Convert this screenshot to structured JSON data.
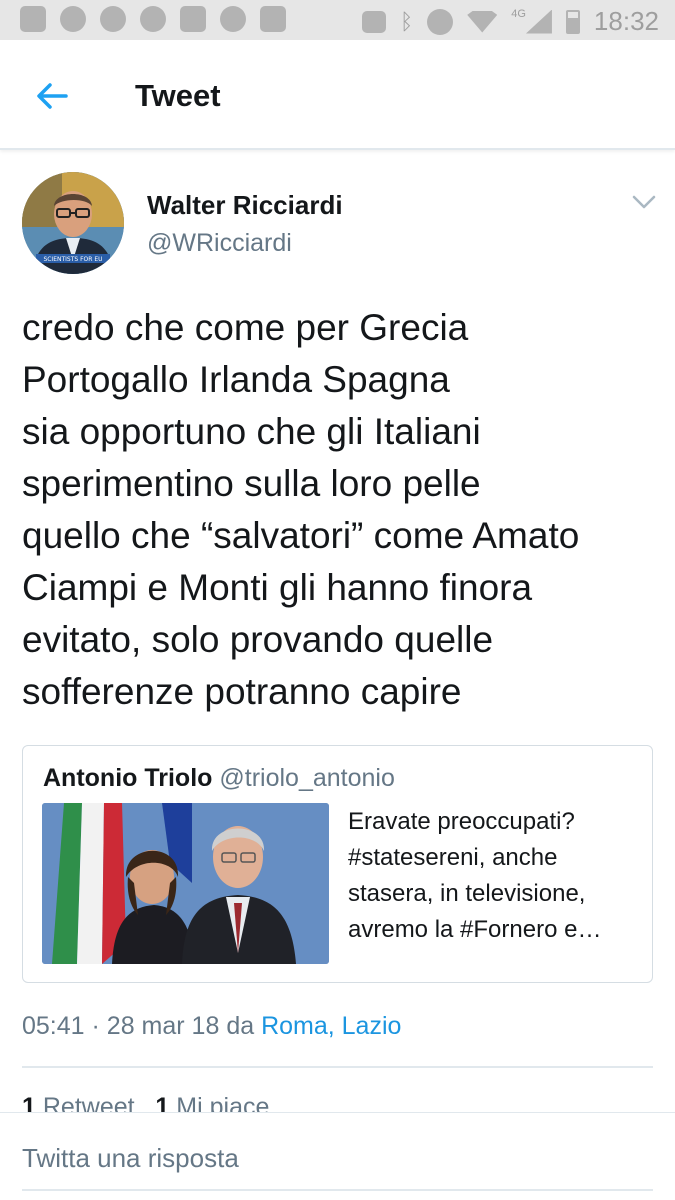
{
  "status_bar": {
    "time": "18:32",
    "network": "4G",
    "left_icons": [
      "chat-icon",
      "chrome-icon",
      "camera-icon",
      "alarm-icon",
      "gmail-icon",
      "whatsapp-icon",
      "app-icon"
    ],
    "right_icons": [
      "cast-icon",
      "bluetooth-icon",
      "alarm-icon",
      "wifi-icon",
      "signal-icon",
      "battery-icon"
    ]
  },
  "header": {
    "title": "Tweet",
    "back_icon": "arrow-left-icon",
    "accent_color": "#1da1f2"
  },
  "tweet": {
    "author_name": "Walter Ricciardi",
    "author_handle": "@WRicciardi",
    "avatar_caption": "SCIENTISTS FOR EU",
    "text_lines": [
      "credo che come per Grecia",
      "Portogallo Irlanda Spagna",
      "sia opportuno che gli Italiani",
      "sperimentino sulla loro pelle",
      "quello che “salvatori” come Amato",
      "Ciampi e Monti gli hanno finora",
      "evitato, solo provando quelle",
      "sofferenze potranno capire"
    ],
    "quoted": {
      "name": "Antonio Triolo",
      "handle": "@triolo_antonio",
      "text_lines": [
        "Eravate preoccupati?",
        "#statesereni, anche",
        "stasera, in televisione,",
        "avremo la #Fornero e…"
      ]
    },
    "meta": {
      "time": "05:41",
      "separator": "·",
      "date": "28 mar 18",
      "from": "da",
      "location": "Roma, Lazio"
    },
    "stats": {
      "retweets_count": "1",
      "retweets_label": "Retweet",
      "likes_count": "1",
      "likes_label": "Mi piace"
    }
  },
  "reply": {
    "placeholder": "Twitta una risposta"
  }
}
